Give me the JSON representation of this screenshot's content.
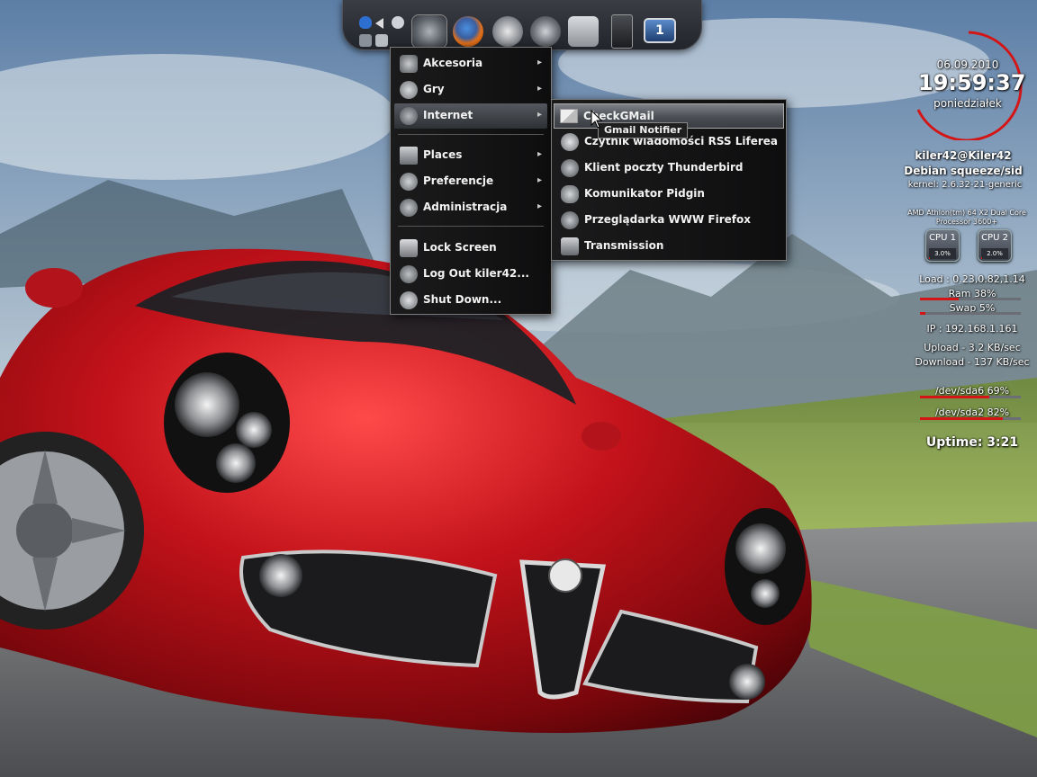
{
  "dock": {
    "items": [
      {
        "name": "main-menu-icon"
      },
      {
        "name": "firefox-icon"
      },
      {
        "name": "rss-feed-icon"
      },
      {
        "name": "globe-icon"
      },
      {
        "name": "joystick-icon"
      },
      {
        "name": "speaker-icon"
      },
      {
        "name": "workspace-switcher",
        "label": "1"
      }
    ],
    "tray": [
      "shield-icon",
      "volume-icon",
      "bluetooth-icon",
      "network-icon",
      "keyboard-icon"
    ]
  },
  "main_menu": {
    "items": [
      {
        "label": "Akcesoria",
        "icon": "accessories-icon",
        "submenu": true
      },
      {
        "label": "Gry",
        "icon": "games-icon",
        "submenu": true
      },
      {
        "label": "Internet",
        "icon": "internet-icon",
        "submenu": true,
        "active": true
      },
      {
        "label": "Places",
        "icon": "places-icon",
        "submenu": true
      },
      {
        "label": "Preferencje",
        "icon": "preferences-icon",
        "submenu": true
      },
      {
        "label": "Administracja",
        "icon": "administration-icon",
        "submenu": true
      },
      {
        "label": "Lock Screen",
        "icon": "lock-screen-icon"
      },
      {
        "label": "Log Out kiler42...",
        "icon": "log-out-icon"
      },
      {
        "label": "Shut Down...",
        "icon": "shut-down-icon"
      }
    ],
    "arrow": "▸"
  },
  "internet_menu": {
    "items": [
      {
        "label": "CheckGMail",
        "icon": "mail-envelope-icon",
        "highlighted": true
      },
      {
        "label": "Czytnik wiadomości RSS Liferea",
        "icon": "rss-reader-icon"
      },
      {
        "label": "Klient poczty Thunderbird",
        "icon": "thunderbird-icon"
      },
      {
        "label": "Komunikator Pidgin",
        "icon": "pidgin-icon"
      },
      {
        "label": "Przeglądarka WWW Firefox",
        "icon": "firefox-icon"
      },
      {
        "label": "Transmission",
        "icon": "transmission-icon"
      }
    ]
  },
  "tooltip": "Gmail Notifier",
  "conky": {
    "date": "06.09.2010",
    "time": "19:59:37",
    "weekday": "poniedziałek",
    "user": "kiler42@Kiler42",
    "os": "Debian squeeze/sid",
    "kernel": "kernel: 2.6.32-21-generic",
    "cpu_model_1": "AMD Athlon(tm) 64 X2 Dual Core",
    "cpu_model_2": "Processor 3600+",
    "cpu1": {
      "label": "CPU 1",
      "value": "3.0%",
      "fraction": 0.03
    },
    "cpu2": {
      "label": "CPU 2",
      "value": "2.0%",
      "fraction": 0.02
    },
    "load": "Load : 0.23,0.82,1.14",
    "ram": {
      "label": "Ram 38%",
      "fraction": 0.38
    },
    "swap": {
      "label": "Swap 5%",
      "fraction": 0.05
    },
    "ip": "IP : 192.168.1.161",
    "upload": "Upload - 3.2 KB/sec",
    "download": "Download - 137 KB/sec",
    "disk1": {
      "label": "/dev/sda6 69%",
      "fraction": 0.69
    },
    "disk2": {
      "label": "/dev/sda2 82%",
      "fraction": 0.82
    },
    "uptime": "Uptime: 3:21"
  },
  "colors": {
    "accent": "#d41515",
    "menu_bg": "#141415",
    "car_red": "#b01818"
  }
}
